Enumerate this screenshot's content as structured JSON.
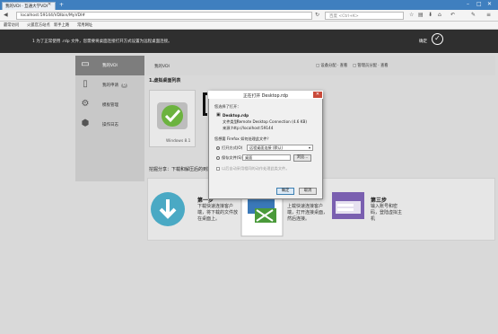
{
  "browser": {
    "tab_title": "我的VDI · 互通大学VDI",
    "new_tab": "+",
    "url": "localhost:59144/VDIbin/MyVDI#",
    "search_placeholder": "百度 <Ctrl+K>",
    "bookmarks": [
      "最常访问",
      "火狐官方站点",
      "新手上路",
      "常用网址"
    ],
    "window_controls": [
      "–",
      "□",
      "✕"
    ]
  },
  "banner": {
    "text": "1 为了正常使用 .rdp 文件，您需要将桌面连接打开方式设置为远程桌面连接。",
    "button": "确定"
  },
  "sidebar": {
    "items": [
      {
        "label": "我的VDI",
        "icon": "monitor-icon",
        "active": true
      },
      {
        "label": "我的申请",
        "icon": "document-icon",
        "badge": "0",
        "active": false
      },
      {
        "label": "模板管理",
        "icon": "gear-icon",
        "active": false
      },
      {
        "label": "操作日志",
        "icon": "shield-icon",
        "active": false
      }
    ]
  },
  "content": {
    "crumb": "我的VDI",
    "top_links": [
      "□ 设备分配 · 查看",
      "□ 管理员分配 · 查看"
    ],
    "section1_title": "1.虚拟桌面列表",
    "vm_label": "Windows 8.1",
    "section2_title": "挖掘分享：下载和解压后的到需要的桌面开始，就可以连接到桌面的远端桌面。",
    "steps": [
      {
        "title": "第一步",
        "text": "下载快速连接客户端，将下载的文件放在桌面上。"
      },
      {
        "title": "",
        "text": "上载快速连接客户端，打开连接桌面，然后连接。"
      },
      {
        "title": "第三步",
        "text": "输入账号和密码，登陆虚拟主机"
      }
    ]
  },
  "dialog": {
    "title": "正在打开 Desktop.rdp",
    "intro": "您选择了打开：",
    "filename": "Desktop.rdp",
    "filetype_label": "文件类型：",
    "filetype": "Remote Desktop Connection (4.6 KB)",
    "source_label": "来源：",
    "source": "http://localhost:59144",
    "question": "您想要 Firefox 如何处理此文件？",
    "open_with_label": "打开方式(O)",
    "open_with_value": "远程桌面连接 (默认)",
    "save_label": "保存文件(S)",
    "save_value": "桌面",
    "browse": "浏览...",
    "remember": "以后自动采用相同的动作处理此类文件。",
    "ok": "确定",
    "cancel": "取消",
    "close": "✕"
  }
}
